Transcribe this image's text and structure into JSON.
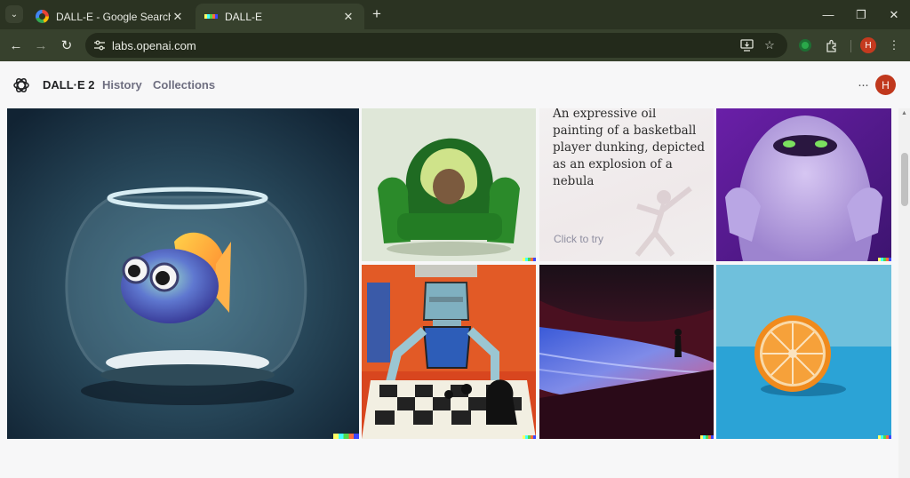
{
  "browser": {
    "tabs": [
      {
        "title": "DALL-E - Google Search",
        "active": false,
        "icon": "google-icon"
      },
      {
        "title": "DALL-E",
        "active": true,
        "icon": "dalle-favicon"
      }
    ],
    "new_tab_glyph": "+",
    "close_glyph": "✕",
    "window_controls": {
      "minimize": "—",
      "restore": "❐",
      "close": "✕"
    },
    "url": "labs.openai.com",
    "profile_initial": "H"
  },
  "app": {
    "brand": "DALL·E 2",
    "nav": [
      "History",
      "Collections"
    ],
    "more_glyph": "···",
    "avatar_initial": "H"
  },
  "gallery": {
    "prompt_card": {
      "text": "An expressive oil painting of a basketball player dunking, depicted as an explosion of a nebula",
      "cta": "Click to try"
    },
    "images": [
      "fish-bowl-image",
      "avocado-armchair-image",
      "furry-monster-image",
      "robot-chess-painting-image",
      "desert-dunes-image",
      "orange-half-image"
    ]
  },
  "colors": {
    "tabbar": "#2b3322",
    "toolbar": "#37412d",
    "page_bg": "#f7f7f8",
    "avatar": "#c0381d"
  }
}
